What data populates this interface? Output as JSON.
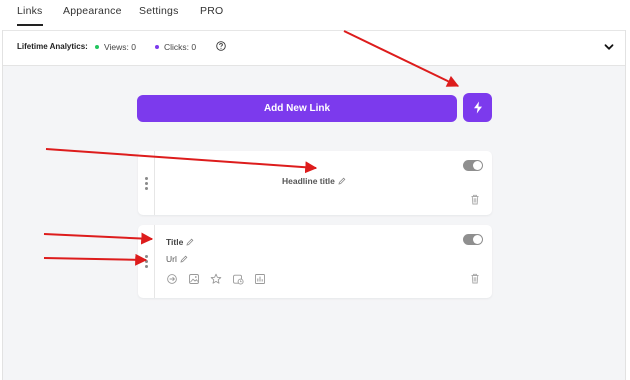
{
  "tabs": [
    {
      "label": "Links",
      "active": true
    },
    {
      "label": "Appearance",
      "active": false
    },
    {
      "label": "Settings",
      "active": false
    },
    {
      "label": "PRO",
      "active": false
    }
  ],
  "analytics": {
    "label": "Lifetime Analytics:",
    "views_label": "Views: 0",
    "clicks_label": "Clicks: 0",
    "views_color": "#22c55e",
    "clicks_color": "#7c3aed"
  },
  "toolbar": {
    "add_link_label": "Add New Link",
    "accent": "#7c3aed"
  },
  "cards": {
    "headline": {
      "title": "Headline title",
      "enabled": true
    },
    "link": {
      "title": "Title",
      "url": "Url",
      "enabled": true,
      "tools": [
        "redirect-icon",
        "thumbnail-icon",
        "star-icon",
        "schedule-icon",
        "analytics-icon"
      ]
    }
  },
  "annotation_color": "#dd1c1c"
}
